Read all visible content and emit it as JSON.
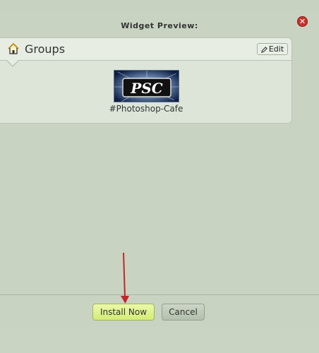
{
  "dialog": {
    "title": "Widget Preview:",
    "close_icon": "close-icon"
  },
  "widget": {
    "title": "Groups",
    "title_icon": "home-icon",
    "edit_label": "Edit",
    "edit_icon": "pencil-icon",
    "group_name": "#Photoshop-Cafe",
    "logo_text": "PSC"
  },
  "footer": {
    "install_label": "Install Now",
    "cancel_label": "Cancel"
  },
  "colors": {
    "background": "#c8d4c1",
    "install_button": "#d4ec75",
    "close_button": "#c8342b",
    "annotation_arrow": "#c0282a"
  }
}
